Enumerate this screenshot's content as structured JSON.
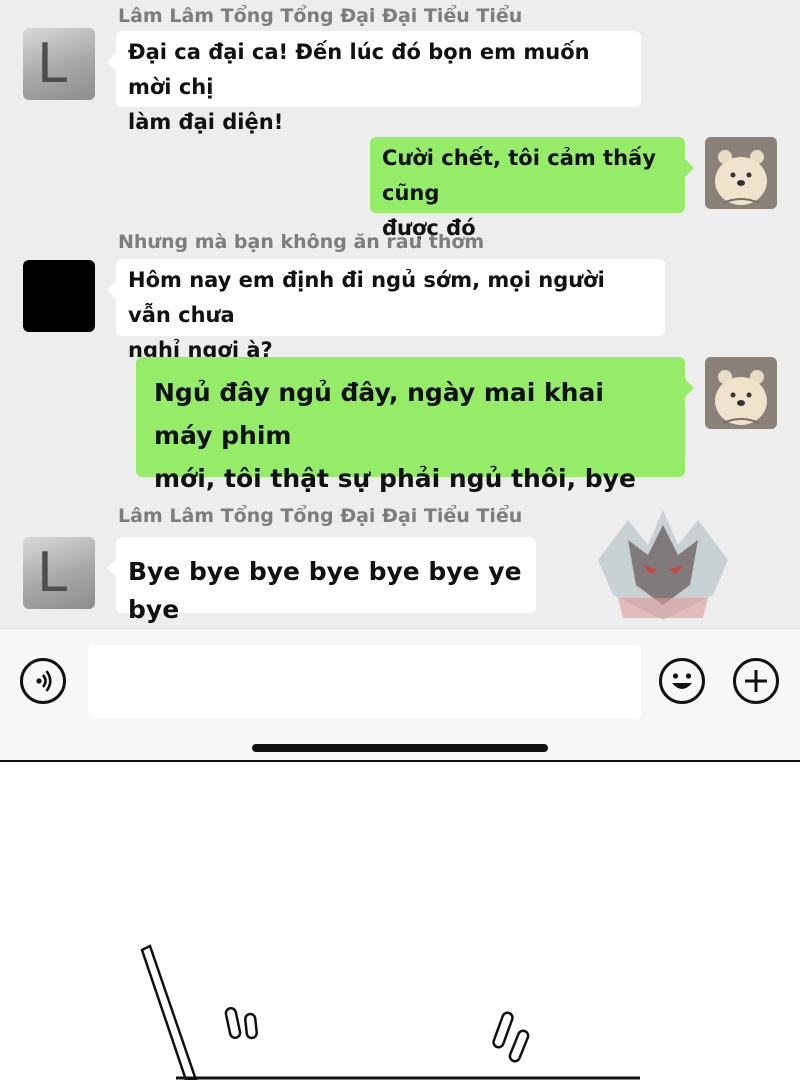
{
  "messages": [
    {
      "side": "left",
      "sender": "Lâm Lâm Tổng Tổng Đại Đại Tiểu Tiểu",
      "avatar": "letter-L-avatar",
      "text": "Đại ca đại ca! Đến lúc đó bọn em muốn mời chị\nlàm đại diện!"
    },
    {
      "side": "right",
      "avatar": "bear-avatar",
      "text": "Cười chết, tôi cảm thấy cũng\nđược đó"
    },
    {
      "side": "left",
      "sender": "Nhưng mà bạn không ăn rau thơm",
      "avatar": "black-avatar",
      "text": "Hôm nay em định đi ngủ sớm, mọi người vẫn chưa\nnghỉ ngơi à?"
    },
    {
      "side": "right",
      "avatar": "bear-avatar",
      "text": "Ngủ đây ngủ đây, ngày mai khai máy phim\nmới, tôi thật sự phải ngủ thôi, bye"
    },
    {
      "side": "left",
      "sender": "Lâm Lâm Tổng Tổng Đại Đại Tiểu Tiểu",
      "avatar": "letter-L-avatar",
      "text": "Bye bye bye bye bye bye ye bye"
    }
  ],
  "avatar_letter": "L",
  "input_bar": {
    "message_value": "",
    "icons": [
      "voice-icon",
      "emoji-icon",
      "plus-icon"
    ]
  },
  "colors": {
    "chat_background": "#ededed",
    "incoming_bubble": "#ffffff",
    "outgoing_bubble": "#95ec69",
    "sender_name": "#7d7d7d"
  }
}
